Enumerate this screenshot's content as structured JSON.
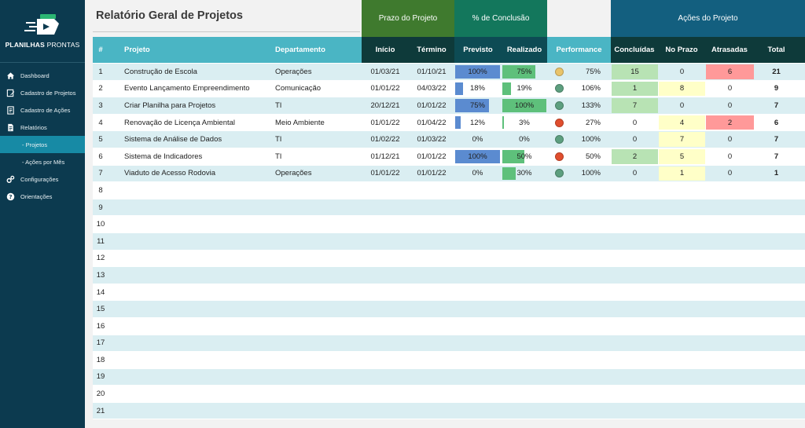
{
  "brand": {
    "name_bold": "PLANILHAS",
    "name_thin": " PRONTAS"
  },
  "nav": [
    {
      "label": "Dashboard",
      "icon": "home-icon",
      "sub": false,
      "active": false
    },
    {
      "label": "Cadastro de Projetos",
      "icon": "pencil-icon",
      "sub": false,
      "active": false
    },
    {
      "label": "Cadastro de Ações",
      "icon": "clipboard-icon",
      "sub": false,
      "active": false
    },
    {
      "label": "Relatórios",
      "icon": "document-icon",
      "sub": false,
      "active": false
    },
    {
      "label": "- Projetos",
      "icon": "",
      "sub": true,
      "active": true
    },
    {
      "label": "- Ações por Mês",
      "icon": "",
      "sub": true,
      "active": false
    },
    {
      "label": "Configurações",
      "icon": "gears-icon",
      "sub": false,
      "active": false
    },
    {
      "label": "Orientações",
      "icon": "question-icon",
      "sub": false,
      "active": false
    }
  ],
  "page": {
    "title": "Relatório Geral de Projetos"
  },
  "groups": {
    "prazo": "Prazo do Projeto",
    "conclusao": "% de Conclusão",
    "acoes": "Ações do Projeto"
  },
  "columns": {
    "num": "#",
    "projeto": "Projeto",
    "departamento": "Departamento",
    "inicio": "Início",
    "termino": "Término",
    "previsto": "Previsto",
    "realizado": "Realizado",
    "performance": "Performance",
    "concluidas": "Concluídas",
    "no_prazo": "No Prazo",
    "atrasadas": "Atrasadas",
    "total": "Total"
  },
  "colors": {
    "sidebar": "#0c3a4f",
    "header": "#4ab5c4",
    "green": "#5ec07b",
    "blue": "#5b8bd0",
    "yellow": "#ffffc8",
    "red": "#ff9999",
    "lightgreen": "#b8e3b4"
  },
  "rows": [
    {
      "num": "1",
      "projeto": "Construção de Escola",
      "departamento": "Operações",
      "inicio": "01/03/21",
      "termino": "01/10/21",
      "previsto": "100%",
      "previsto_v": 1.0,
      "realizado": "75%",
      "realizado_v": 0.75,
      "performance": "75%",
      "status": "yellow",
      "concluidas": "15",
      "no_prazo": "0",
      "atrasadas": "6",
      "total": "21"
    },
    {
      "num": "2",
      "projeto": "Evento Lançamento Empreendimento",
      "departamento": "Comunicação",
      "inicio": "01/01/22",
      "termino": "04/03/22",
      "previsto": "18%",
      "previsto_v": 0.18,
      "realizado": "19%",
      "realizado_v": 0.19,
      "performance": "106%",
      "status": "green",
      "concluidas": "1",
      "no_prazo": "8",
      "atrasadas": "0",
      "total": "9"
    },
    {
      "num": "3",
      "projeto": "Criar Planilha para Projetos",
      "departamento": "TI",
      "inicio": "20/12/21",
      "termino": "01/01/22",
      "previsto": "75%",
      "previsto_v": 0.75,
      "realizado": "100%",
      "realizado_v": 1.0,
      "performance": "133%",
      "status": "green",
      "concluidas": "7",
      "no_prazo": "0",
      "atrasadas": "0",
      "total": "7"
    },
    {
      "num": "4",
      "projeto": "Renovação de Licença Ambiental",
      "departamento": "Meio Ambiente",
      "inicio": "01/01/22",
      "termino": "01/04/22",
      "previsto": "12%",
      "previsto_v": 0.12,
      "realizado": "3%",
      "realizado_v": 0.03,
      "performance": "27%",
      "status": "red",
      "concluidas": "0",
      "no_prazo": "4",
      "atrasadas": "2",
      "total": "6"
    },
    {
      "num": "5",
      "projeto": "Sistema de Análise de Dados",
      "departamento": "TI",
      "inicio": "01/02/22",
      "termino": "01/03/22",
      "previsto": "0%",
      "previsto_v": 0.0,
      "realizado": "0%",
      "realizado_v": 0.0,
      "performance": "100%",
      "status": "green",
      "concluidas": "0",
      "no_prazo": "7",
      "atrasadas": "0",
      "total": "7"
    },
    {
      "num": "6",
      "projeto": "Sistema de Indicadores",
      "departamento": "TI",
      "inicio": "01/12/21",
      "termino": "01/01/22",
      "previsto": "100%",
      "previsto_v": 1.0,
      "realizado": "50%",
      "realizado_v": 0.5,
      "performance": "50%",
      "status": "red",
      "concluidas": "2",
      "no_prazo": "5",
      "atrasadas": "0",
      "total": "7"
    },
    {
      "num": "7",
      "projeto": "Viaduto de Acesso Rodovia",
      "departamento": "Operações",
      "inicio": "01/01/22",
      "termino": "01/01/22",
      "previsto": "0%",
      "previsto_v": 0.0,
      "realizado": "30%",
      "realizado_v": 0.3,
      "performance": "100%",
      "status": "green",
      "concluidas": "0",
      "no_prazo": "1",
      "atrasadas": "0",
      "total": "1"
    }
  ],
  "empty_rows": [
    "8",
    "9",
    "10",
    "11",
    "12",
    "13",
    "14",
    "15",
    "16",
    "17",
    "18",
    "19",
    "20",
    "21"
  ]
}
